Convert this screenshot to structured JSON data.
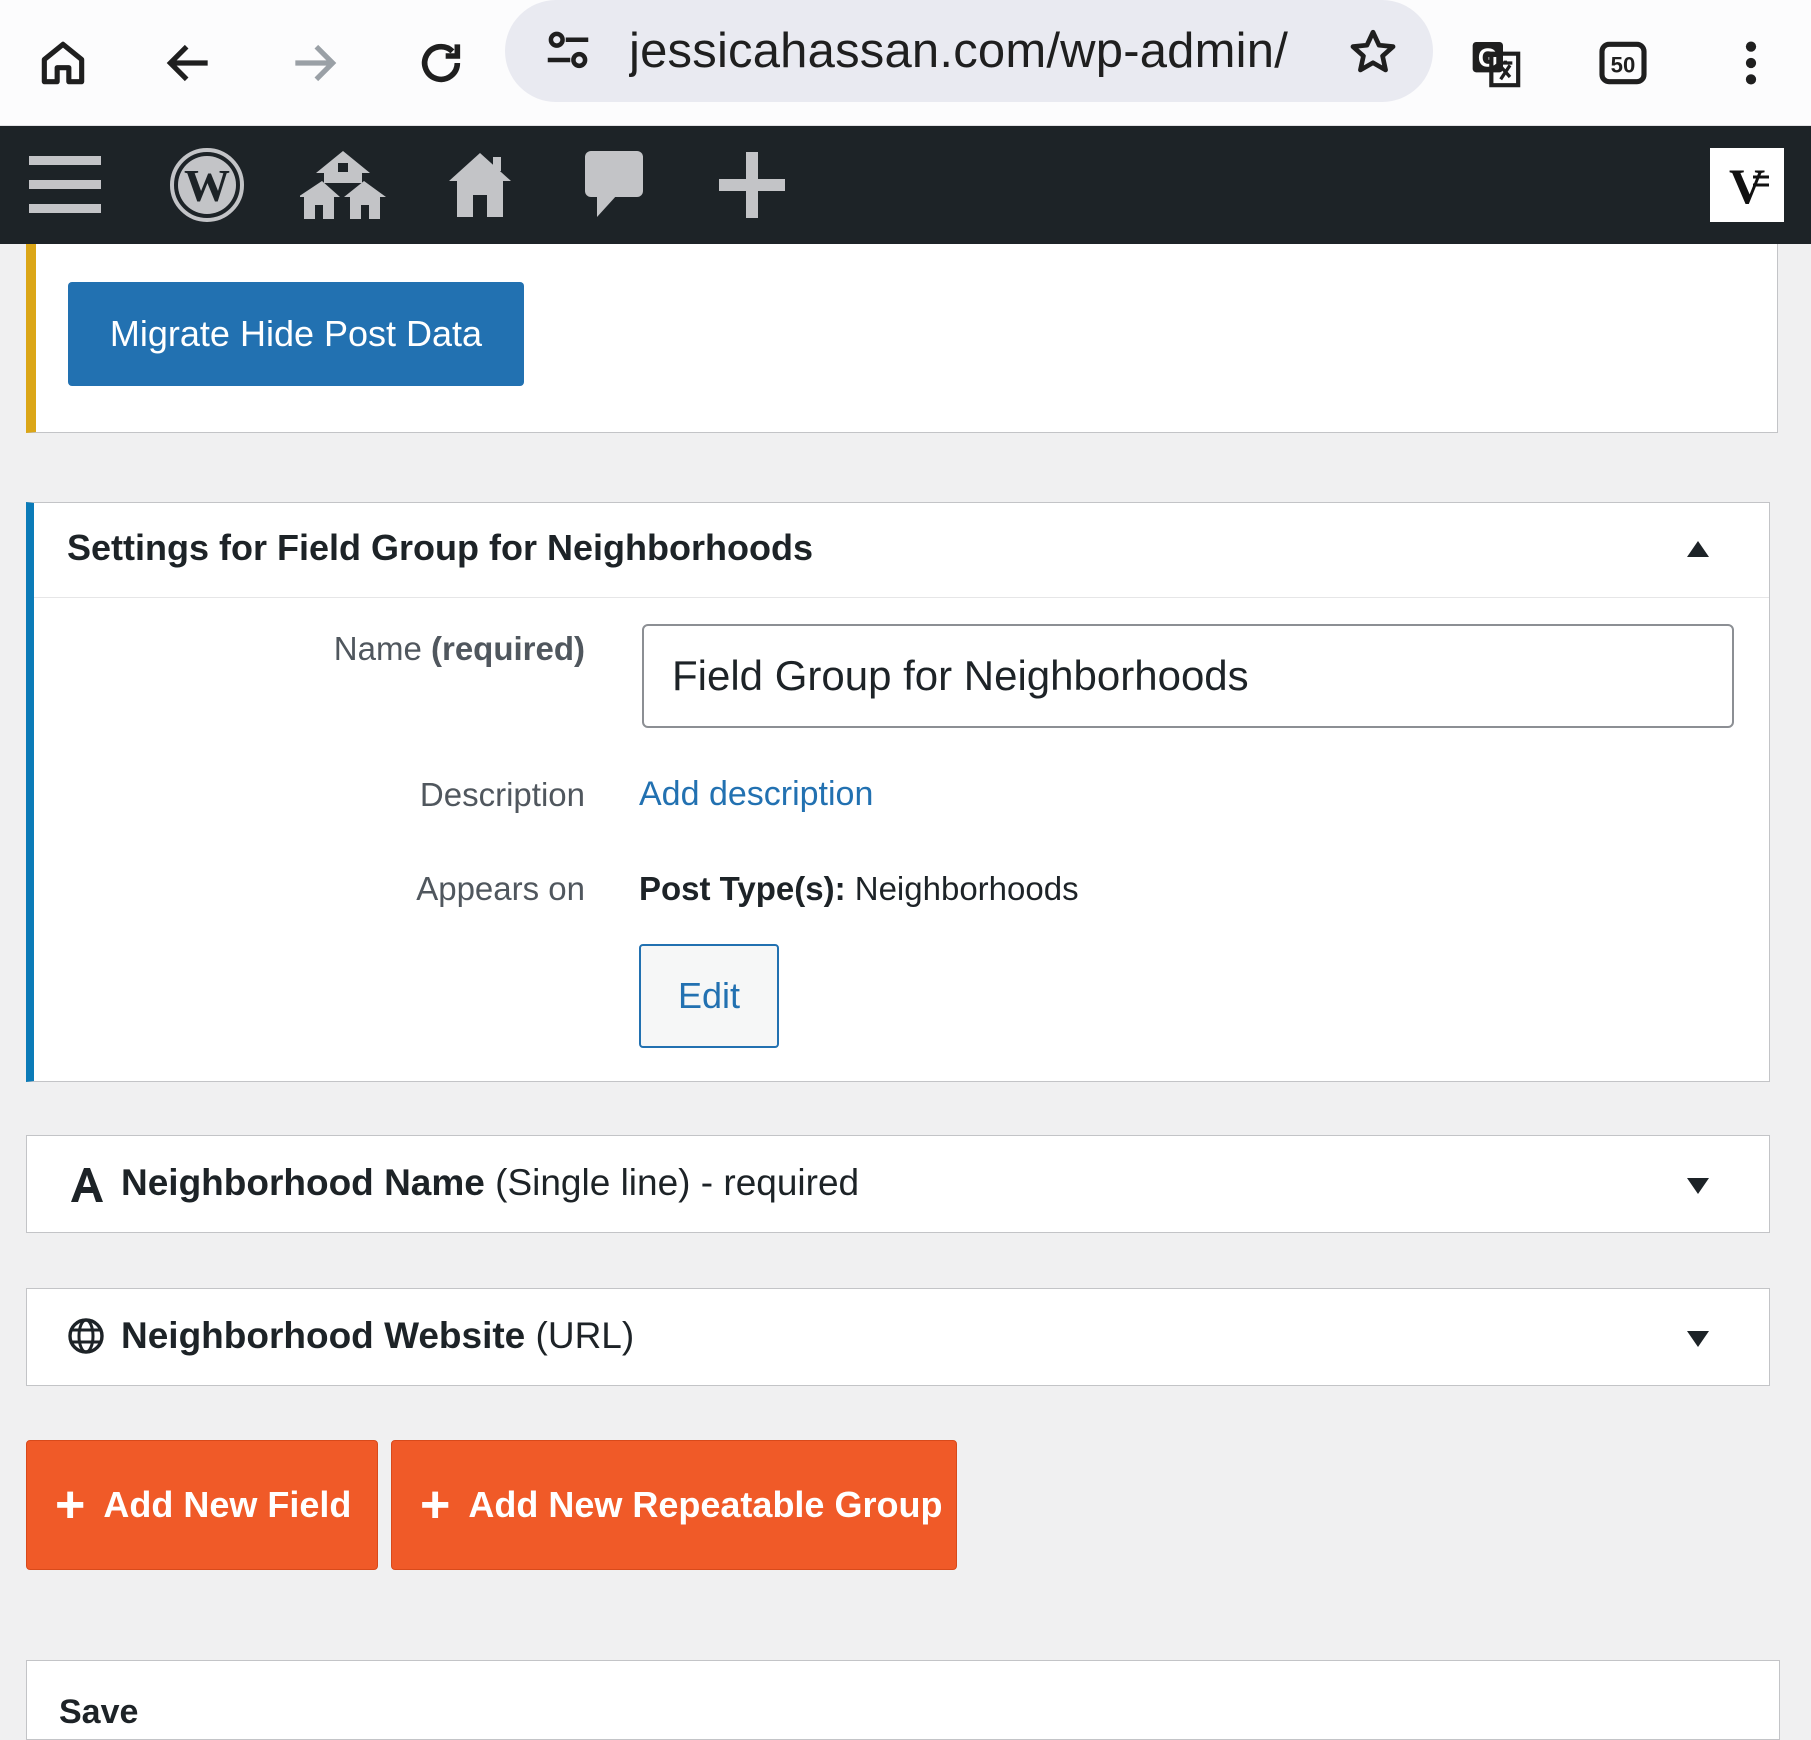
{
  "browser": {
    "url": "jessicahassan.com/wp-admin/",
    "tab_count": "50",
    "icons": [
      "home-icon",
      "back-arrow-icon",
      "forward-arrow-icon",
      "reload-icon",
      "site-settings-icon",
      "star-icon",
      "translate-icon",
      "tabs-icon",
      "more-vert-icon"
    ]
  },
  "adminbar": {
    "icons": [
      "menu-icon",
      "wordpress-logo-icon",
      "my-sites-icon",
      "site-home-icon",
      "comments-icon",
      "new-content-icon",
      "avatar-icon"
    ],
    "avatar_letter": "V"
  },
  "notice": {
    "button_label": "Migrate Hide Post Data",
    "accent_color": "#dba617"
  },
  "settings": {
    "title": "Settings for Field Group for Neighborhoods",
    "name_label": "Name",
    "name_required": "(required)",
    "name_value": "Field Group for Neighborhoods",
    "description_label": "Description",
    "description_link": "Add description",
    "appears_label": "Appears on",
    "post_types_label": "Post Type(s):",
    "post_types_value": " Neighborhoods",
    "edit_label": "Edit"
  },
  "fields": [
    {
      "icon": "text-a-icon",
      "name": "Neighborhood Name",
      "meta": " (Single line) - required"
    },
    {
      "icon": "globe-icon",
      "name": "Neighborhood Website",
      "meta": " (URL)"
    }
  ],
  "actions": {
    "add_field": "Add New Field",
    "add_group": "Add New Repeatable Group",
    "plus": "+"
  },
  "save": {
    "title": "Save"
  },
  "colors": {
    "primary": "#2271b1",
    "orange": "#f05a28",
    "adminbar": "#1d2327"
  }
}
